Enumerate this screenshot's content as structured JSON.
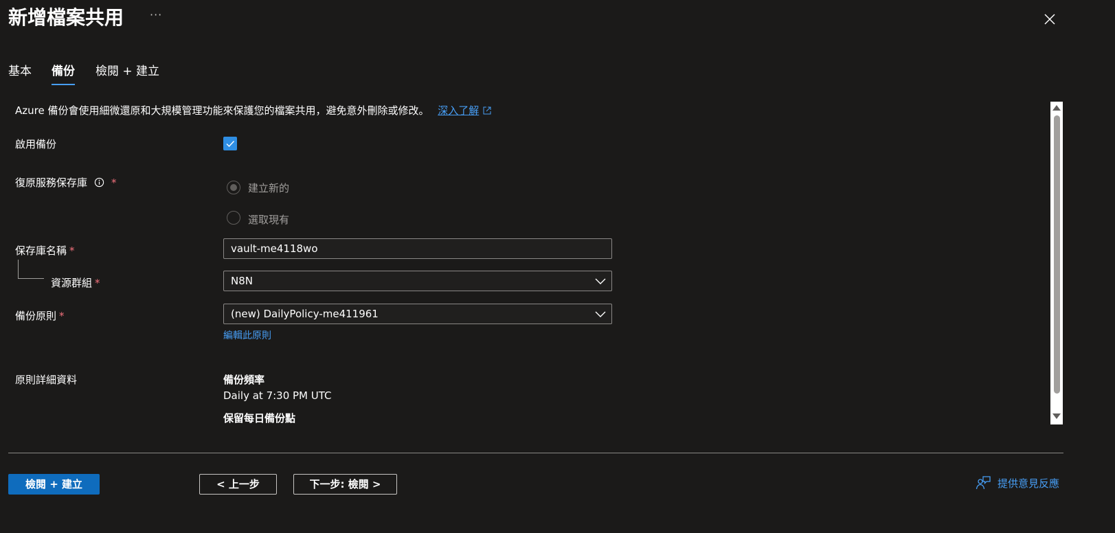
{
  "header": {
    "title": "新增檔案共用",
    "more_label": "···"
  },
  "tabs": [
    {
      "label": "基本",
      "active": false
    },
    {
      "label": "備份",
      "active": true
    },
    {
      "label": "檢閱 + 建立",
      "active": false
    }
  ],
  "content": {
    "description": "Azure 備份會使用細微還原和大規模管理功能來保護您的檔案共用，避免意外刪除或修改。",
    "learn_more": "深入了解",
    "enable_backup": {
      "label": "啟用備份",
      "checked": true
    },
    "vault": {
      "label": "復原服務保存庫",
      "required": "*",
      "options": [
        {
          "label": "建立新的",
          "selected": true
        },
        {
          "label": "選取現有",
          "selected": false
        }
      ]
    },
    "vault_name": {
      "label": "保存庫名稱",
      "required": "*",
      "value": "vault-me4118wo"
    },
    "resource_group": {
      "label": "資源群組",
      "required": "*",
      "value": "N8N"
    },
    "backup_policy": {
      "label": "備份原則",
      "required": "*",
      "value": "(new) DailyPolicy-me411961",
      "edit_link": "編輯此原則"
    },
    "policy_details": {
      "label": "原則詳細資料",
      "frequency_title": "備份頻率",
      "frequency_value": "Daily at 7:30 PM UTC",
      "retention_title": "保留每日備份點"
    }
  },
  "footer": {
    "review_create": "檢閱 + 建立",
    "previous": "< 上一步",
    "next": "下一步: 檢閱 >",
    "feedback": "提供意見反應"
  },
  "colors": {
    "background": "#1b1a19",
    "accent": "#479ef5",
    "primary_button": "#0f6cbd",
    "required": "#f1707b"
  }
}
